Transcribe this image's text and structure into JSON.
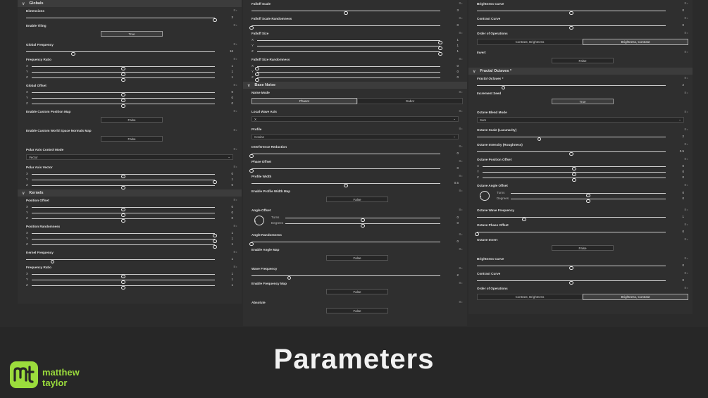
{
  "footer": {
    "title": "Parameters",
    "brand_line1": "matthew",
    "brand_line2": "taylor"
  },
  "columns": [
    [
      {
        "kind": "section",
        "title": "Globals"
      },
      {
        "kind": "slider",
        "label": "Dimensions",
        "rows": [
          {
            "axis": "",
            "pos": 1.0,
            "value": "3"
          }
        ]
      },
      {
        "kind": "button",
        "label": "Enable Tiling",
        "value": "True",
        "light": true
      },
      {
        "kind": "slider",
        "label": "Global Frequency",
        "rows": [
          {
            "axis": "",
            "pos": 0.25,
            "value": "16"
          }
        ]
      },
      {
        "kind": "slider",
        "label": "Frequency Ratio",
        "rows": [
          {
            "axis": "X",
            "pos": 0.5,
            "value": "1"
          },
          {
            "axis": "Y",
            "pos": 0.5,
            "value": "1"
          },
          {
            "axis": "Z",
            "pos": 0.5,
            "value": "1"
          }
        ]
      },
      {
        "kind": "slider",
        "label": "Global Offset",
        "rows": [
          {
            "axis": "X",
            "pos": 0.5,
            "value": "0"
          },
          {
            "axis": "Y",
            "pos": 0.5,
            "value": "0"
          },
          {
            "axis": "Z",
            "pos": 0.5,
            "value": "0"
          }
        ]
      },
      {
        "kind": "button",
        "label": "Enable Custom Position Map",
        "value": "False"
      },
      {
        "kind": "button",
        "label": "Enable Custom World Space Normals Map",
        "value": "False"
      },
      {
        "kind": "dropdown",
        "label": "Polar Axis Control Mode",
        "value": "Vector"
      },
      {
        "kind": "slider",
        "label": "Polar Axis Vector",
        "rows": [
          {
            "axis": "X",
            "pos": 0.5,
            "value": "0"
          },
          {
            "axis": "Y",
            "pos": 1.0,
            "value": "1"
          },
          {
            "axis": "Z",
            "pos": 0.5,
            "value": "0"
          }
        ]
      },
      {
        "kind": "section",
        "title": "Kernels"
      },
      {
        "kind": "slider",
        "label": "Position Offset",
        "rows": [
          {
            "axis": "X",
            "pos": 0.5,
            "value": "0"
          },
          {
            "axis": "Y",
            "pos": 0.5,
            "value": "0"
          },
          {
            "axis": "Z",
            "pos": 0.5,
            "value": "0"
          }
        ]
      },
      {
        "kind": "slider",
        "label": "Position Randomness",
        "rows": [
          {
            "axis": "X",
            "pos": 1.0,
            "value": "1"
          },
          {
            "axis": "Y",
            "pos": 1.0,
            "value": "1"
          },
          {
            "axis": "Z",
            "pos": 1.0,
            "value": "1"
          }
        ]
      },
      {
        "kind": "slider",
        "label": "Kernel Frequency",
        "rows": [
          {
            "axis": "",
            "pos": 0.14,
            "value": "1"
          }
        ]
      },
      {
        "kind": "slider",
        "label": "Frequency Ratio",
        "rows": [
          {
            "axis": "X",
            "pos": 0.5,
            "value": "1"
          },
          {
            "axis": "Y",
            "pos": 0.5,
            "value": "1"
          },
          {
            "axis": "Z",
            "pos": 0.5,
            "value": "1"
          }
        ]
      }
    ],
    [
      {
        "kind": "slider",
        "label": "Falloff Scale",
        "rows": [
          {
            "axis": "",
            "pos": 0.5,
            "value": "3"
          }
        ]
      },
      {
        "kind": "slider",
        "label": "Falloff Scale Randomness",
        "rows": [
          {
            "axis": "",
            "pos": 0.0,
            "value": "0"
          }
        ]
      },
      {
        "kind": "slider",
        "label": "Falloff Size",
        "rows": [
          {
            "axis": "X",
            "pos": 1.0,
            "value": "1"
          },
          {
            "axis": "Y",
            "pos": 1.0,
            "value": "1"
          },
          {
            "axis": "Z",
            "pos": 1.0,
            "value": "1"
          }
        ]
      },
      {
        "kind": "slider",
        "label": "Falloff Size Randomness",
        "rows": [
          {
            "axis": "X",
            "pos": 0.0,
            "value": "0"
          },
          {
            "axis": "Y",
            "pos": 0.0,
            "value": "0"
          },
          {
            "axis": "Z",
            "pos": 0.0,
            "value": "0"
          }
        ]
      },
      {
        "kind": "section",
        "title": "Base Noise"
      },
      {
        "kind": "segment",
        "label": "Noise Mode",
        "options": [
          {
            "text": "Phasor",
            "on": true
          },
          {
            "text": "Gabor",
            "on": false
          }
        ]
      },
      {
        "kind": "dropdown",
        "label": "Local Wave Axis",
        "value": "X"
      },
      {
        "kind": "dropdown",
        "label": "Profile",
        "value": "Cosine"
      },
      {
        "kind": "slider",
        "label": "Interference Reduction",
        "rows": [
          {
            "axis": "",
            "pos": 0.0,
            "value": "0"
          }
        ]
      },
      {
        "kind": "slider",
        "label": "Phase Offset",
        "rows": [
          {
            "axis": "",
            "pos": 0.0,
            "value": "0"
          }
        ]
      },
      {
        "kind": "slider",
        "label": "Profile Width",
        "rows": [
          {
            "axis": "",
            "pos": 0.5,
            "value": "0.5"
          }
        ]
      },
      {
        "kind": "button",
        "label": "Enable Profile Width Map",
        "value": "False"
      },
      {
        "kind": "angle",
        "label": "Angle Offset",
        "rows": [
          {
            "name": "Turns",
            "pos": 0.5,
            "value": "0"
          },
          {
            "name": "Degrees",
            "pos": 0.5,
            "value": "0"
          }
        ]
      },
      {
        "kind": "slider",
        "label": "Angle Randomness",
        "rows": [
          {
            "axis": "",
            "pos": 0.0,
            "value": "0"
          }
        ]
      },
      {
        "kind": "button",
        "label": "Enable Angle Map",
        "value": "False"
      },
      {
        "kind": "slider",
        "label": "Wave Frequency",
        "rows": [
          {
            "axis": "",
            "pos": 0.2,
            "value": "2"
          }
        ]
      },
      {
        "kind": "button",
        "label": "Enable Frequency Map",
        "value": "False"
      },
      {
        "kind": "button",
        "label": "Absolute",
        "value": "False"
      }
    ],
    [
      {
        "kind": "slider",
        "label": "Brightness Curve",
        "rows": [
          {
            "axis": "",
            "pos": 0.5,
            "value": "0"
          }
        ]
      },
      {
        "kind": "slider",
        "label": "Contrast Curve",
        "rows": [
          {
            "axis": "",
            "pos": 0.5,
            "value": "0"
          }
        ]
      },
      {
        "kind": "segment",
        "label": "Order of Operations",
        "options": [
          {
            "text": "Contrast, Brightness",
            "on": false
          },
          {
            "text": "Brightness, Contrast",
            "on": true
          }
        ]
      },
      {
        "kind": "button",
        "label": "Invert",
        "value": "False"
      },
      {
        "kind": "section",
        "title": "Fractal Octaves *"
      },
      {
        "kind": "slider",
        "label": "Fractal Octaves *",
        "italic": true,
        "rows": [
          {
            "axis": "",
            "pos": 0.14,
            "value": "2"
          }
        ]
      },
      {
        "kind": "button",
        "label": "Increment Seed",
        "value": "True",
        "light": true
      },
      {
        "kind": "dropdown",
        "label": "Octave Blend Mode",
        "value": "Sum"
      },
      {
        "kind": "slider",
        "label": "Octave Scale (Lacunarity)",
        "rows": [
          {
            "axis": "",
            "pos": 0.33,
            "value": "2"
          }
        ]
      },
      {
        "kind": "slider",
        "label": "Octave Intensity (Roughness)",
        "rows": [
          {
            "axis": "",
            "pos": 0.5,
            "value": "0.5"
          }
        ]
      },
      {
        "kind": "slider",
        "label": "Octave Position Offset",
        "rows": [
          {
            "axis": "X",
            "pos": 0.5,
            "value": "0"
          },
          {
            "axis": "Y",
            "pos": 0.5,
            "value": "0"
          },
          {
            "axis": "Z",
            "pos": 0.5,
            "value": "0"
          }
        ]
      },
      {
        "kind": "angle",
        "label": "Octave Angle Offset",
        "rows": [
          {
            "name": "Turns",
            "pos": 0.5,
            "value": "0"
          },
          {
            "name": "Degrees",
            "pos": 0.5,
            "value": "0"
          }
        ]
      },
      {
        "kind": "slider",
        "label": "Octave Wave Frequency",
        "rows": [
          {
            "axis": "",
            "pos": 0.25,
            "value": "1"
          }
        ]
      },
      {
        "kind": "slider",
        "label": "Octave Phase Offset",
        "rows": [
          {
            "axis": "",
            "pos": 0.0,
            "value": "0"
          }
        ]
      },
      {
        "kind": "button",
        "label": "Octave Invert",
        "value": "False"
      },
      {
        "kind": "slider",
        "label": "Brightness Curve",
        "rows": [
          {
            "axis": "",
            "pos": 0.5,
            "value": "0"
          }
        ]
      },
      {
        "kind": "slider",
        "label": "Contrast Curve",
        "rows": [
          {
            "axis": "",
            "pos": 0.5,
            "value": "0"
          }
        ]
      },
      {
        "kind": "segment",
        "label": "Order of Operations",
        "options": [
          {
            "text": "Contrast, Brightness",
            "on": false
          },
          {
            "text": "Brightness, Contrast",
            "on": true
          }
        ]
      }
    ]
  ]
}
